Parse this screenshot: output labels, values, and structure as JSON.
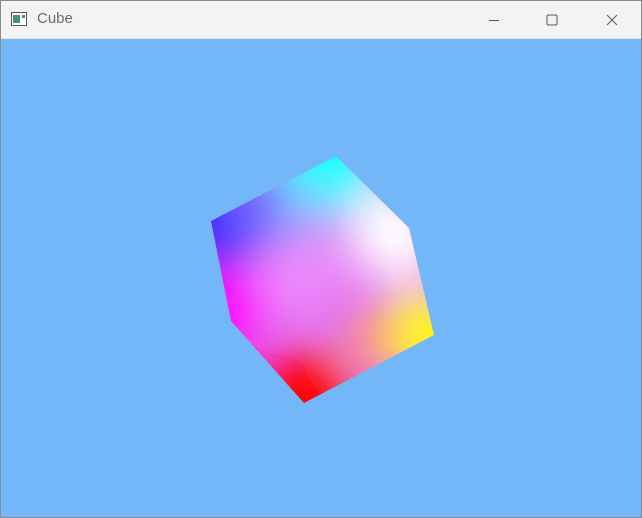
{
  "window": {
    "title": "Cube",
    "background_color": "#74b7f8",
    "icons": {
      "app": "window-app-icon",
      "minimize": "minimize-icon",
      "maximize": "maximize-icon",
      "close": "close-icon"
    }
  },
  "scene": {
    "object": "rgb-color-cube",
    "corner_colors": {
      "top": "#00ffff",
      "left": "#0000ff",
      "right": "#ffffff",
      "center": "#ff00ff",
      "bottom_right": "#ffff00",
      "bottom": "#ff0000"
    }
  }
}
